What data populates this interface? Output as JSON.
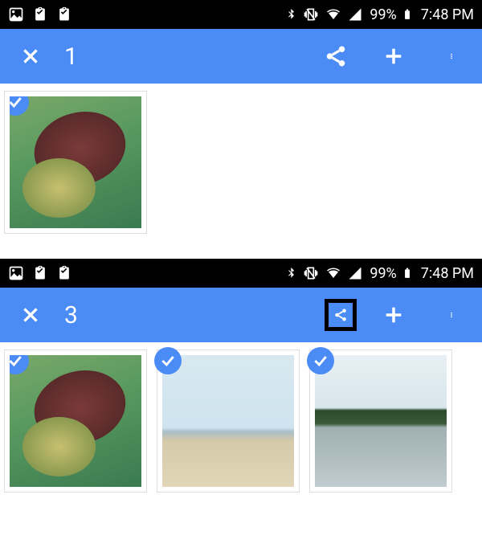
{
  "screens": [
    {
      "status_bar": {
        "battery_pct": "99%",
        "clock": "7:48 PM"
      },
      "toolbar": {
        "selected_count": "1",
        "share_highlighted": false
      },
      "thumbs": [
        {
          "name": "photo-turtle",
          "selected": true
        }
      ]
    },
    {
      "status_bar": {
        "battery_pct": "99%",
        "clock": "7:48 PM"
      },
      "toolbar": {
        "selected_count": "3",
        "share_highlighted": true
      },
      "thumbs": [
        {
          "name": "photo-turtle",
          "selected": true
        },
        {
          "name": "photo-beach",
          "selected": true
        },
        {
          "name": "photo-lake",
          "selected": true
        }
      ]
    }
  ]
}
